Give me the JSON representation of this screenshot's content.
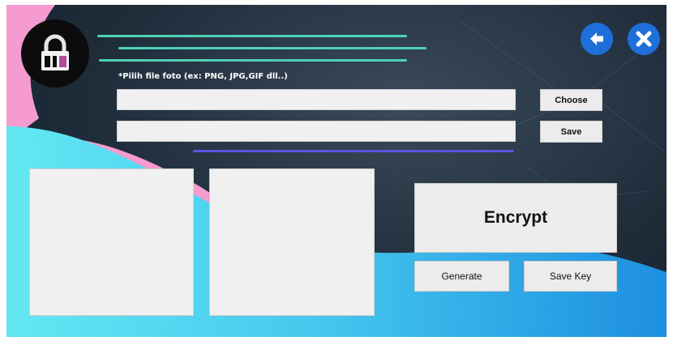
{
  "header": {
    "hint": "*Pilih file foto (ex: PNG, JPG,GIF dll..)"
  },
  "file_inputs": {
    "source_value": "",
    "output_value": ""
  },
  "buttons": {
    "choose": "Choose",
    "save": "Save",
    "encrypt": "Encrypt",
    "generate": "Generate",
    "save_key": "Save Key"
  },
  "icons": {
    "logo": "lock-icon",
    "back": "arrow-left-icon",
    "close": "close-icon"
  },
  "colors": {
    "accent_line": "#4fd1b5",
    "nav_button": "#1e6fd9",
    "divider": "#5a55e0",
    "pink": "#f59bcf",
    "cyan": "#5ce6f0"
  }
}
